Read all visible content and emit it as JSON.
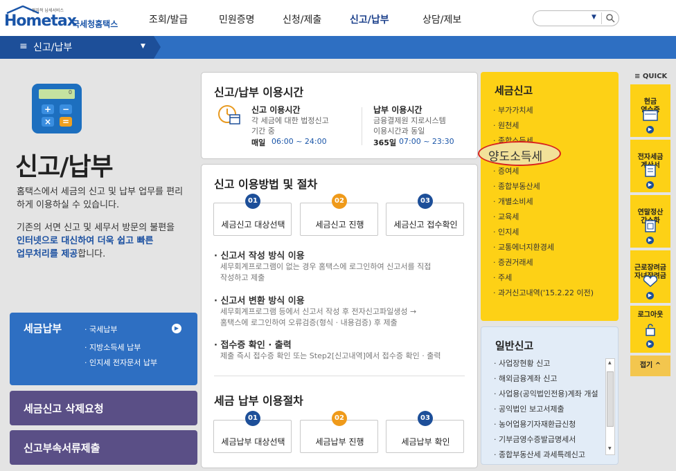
{
  "header": {
    "logo_tag": "전자적 납세서비스",
    "logo_text": "Hometax",
    "logo_korean": "국세청홈택스",
    "nav": [
      "조회/발급",
      "민원증명",
      "신청/제출",
      "신고/납부",
      "상담/제보"
    ],
    "active_nav": "신고/납부"
  },
  "menubar": {
    "label": "신고/납부"
  },
  "calc_display": "0",
  "hero": {
    "title": "신고/납부",
    "desc1": "홈택스에서 세금의 신고 및 납부 업무를 편리하게 이용하실 수 있습니다.",
    "desc2_a": "기존의 서면 신고 및 세무서 방문의 불편을",
    "desc2_b": "인터넷으로 대신하여 더욱 쉽고 빠른",
    "desc2_c": "업무처리를 제공",
    "desc2_d": "합니다."
  },
  "left_buttons": {
    "payment_title": "세금납부",
    "payment_items": [
      "국세납부",
      "지방소득세 납부",
      "인지세 전자문서 납부"
    ],
    "delete_request": "세금신고 삭제요청",
    "attachments": "신고부속서류제출"
  },
  "hours": {
    "title": "신고/납부 이용시간",
    "filing_label": "신고 이용시간",
    "filing_desc1": "각 세금에 대한 법정신고",
    "filing_desc2": "기간 중",
    "filing_days": "매일",
    "filing_time": "06:00 ~ 24:00",
    "pay_label": "납부 이용시간",
    "pay_desc1": "금융결제원 지로시스템",
    "pay_desc2": "이용시간과 동일",
    "pay_days": "365일",
    "pay_time": "07:00 ~ 23:30"
  },
  "procedure": {
    "title": "신고 이용방법 및 절차",
    "steps": [
      {
        "num": "01",
        "label": "세금신고 대상선택"
      },
      {
        "num": "02",
        "label": "세금신고 진행"
      },
      {
        "num": "03",
        "label": "세금신고 접수확인"
      }
    ],
    "methods": [
      {
        "title": "신고서 작성 방식 이용",
        "desc1": "세무회계프로그램이 없는 경우 홈택스에 로그인하여 신고서를 직접",
        "desc2": "작성하고 제출"
      },
      {
        "title": "신고서 변환 방식 이용",
        "desc1": "세무회계프로그램 등에서 신고서 작성 후 전자신고파일생성 →",
        "desc2": "홈택스에 로그인하여 오류검증(형식 · 내용검증) 후 제출"
      },
      {
        "title": "접수증 확인 · 출력",
        "desc1": "제출 즉시 접수증 확인 또는 Step2[신고내역]에서 접수증 확인 · 출력",
        "desc2": ""
      }
    ],
    "pay_title": "세금 납부 이용절차",
    "pay_steps": [
      {
        "num": "01",
        "label": "세금납부 대상선택"
      },
      {
        "num": "02",
        "label": "세금납부 진행"
      },
      {
        "num": "03",
        "label": "세금납부 확인"
      }
    ]
  },
  "tax_filing": {
    "title": "세금신고",
    "items": [
      "부가가치세",
      "원천세",
      "종합소득세",
      "양도소득세",
      "증여세",
      "종합부동산세",
      "개별소비세",
      "교육세",
      "인지세",
      "교통에너지환경세",
      "증권거래세",
      "주세",
      "과거신고내역('15.2.22 이전)"
    ],
    "highlight": "양도소득세"
  },
  "general_filing": {
    "title": "일반신고",
    "items": [
      "사업장현황 신고",
      "해외금융계좌 신고",
      "사업용(공익법인전용)계좌 개설",
      "공익법인 보고서제출",
      "농어업용기자재환급신청",
      "기부금영수증발급명세서",
      "종합부동산세 과세특례신고"
    ]
  },
  "quick": {
    "header": "QUICK",
    "items": [
      "현금\n영수증",
      "전자세금\n계산서",
      "연말정산\n간소화",
      "근로장려금\n자녀장려금",
      "로그아웃"
    ],
    "collapse": "접기"
  },
  "colors": {
    "brand": "#1a55a8",
    "accent_yellow": "#fdd116",
    "step_orange": "#ef9a1a",
    "step_blue": "#1d4f99",
    "highlight_red": "#d9221e"
  }
}
